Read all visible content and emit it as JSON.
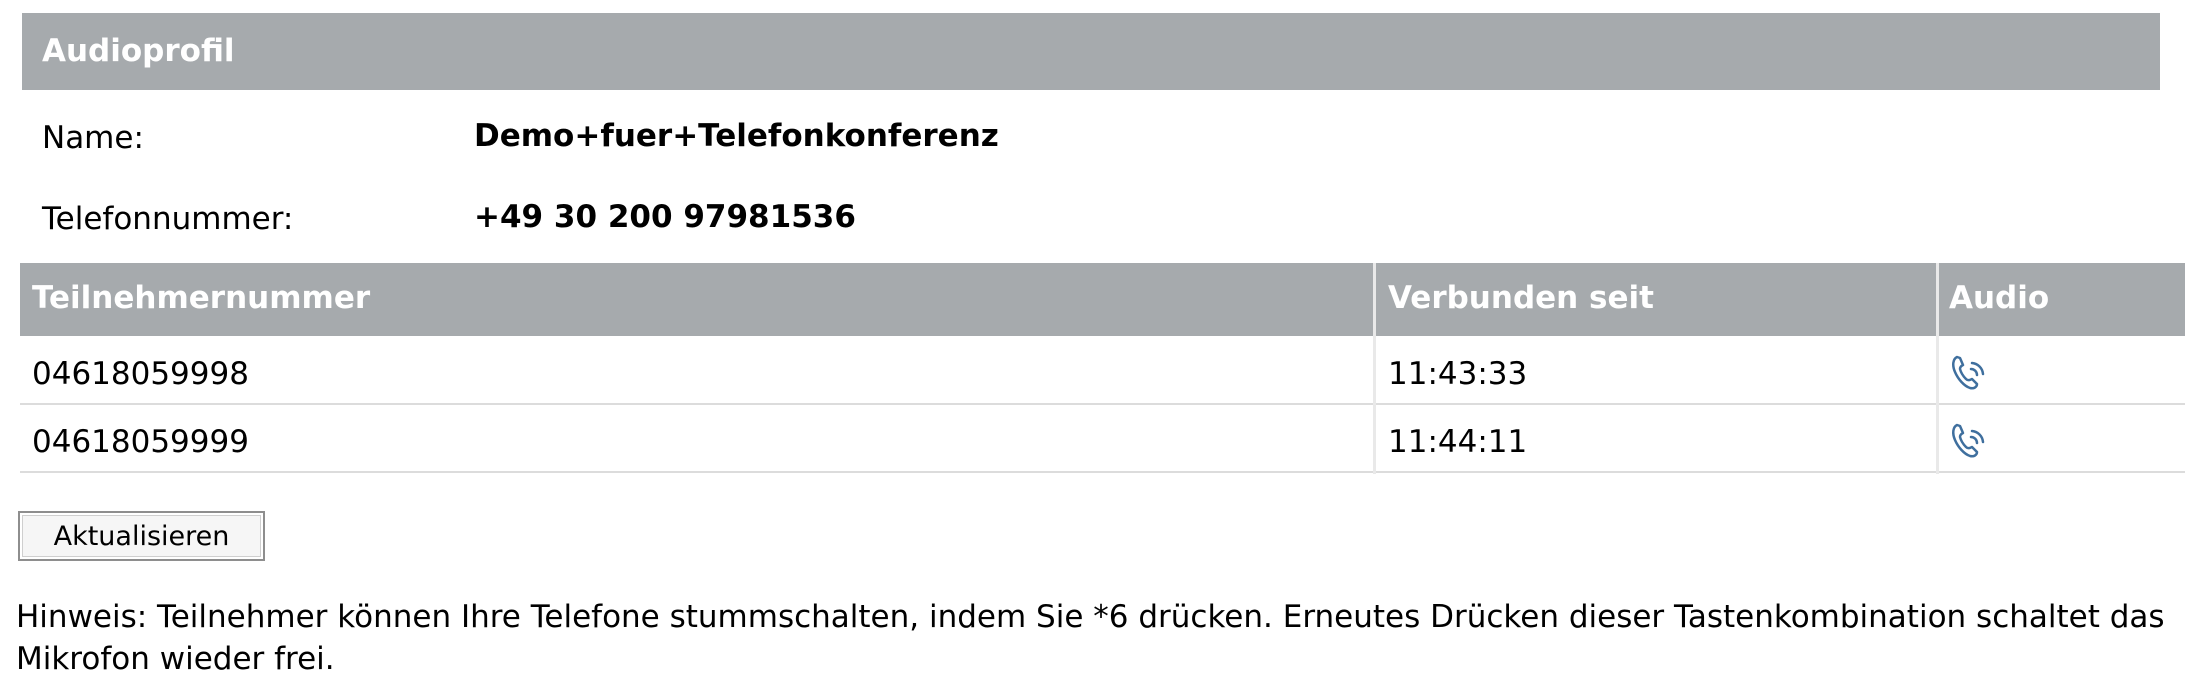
{
  "profile": {
    "header": "Audioprofil",
    "name_label": "Name:",
    "name_value": "Demo+fuer+Telefonkonferenz",
    "phone_label": "Telefonnummer:",
    "phone_value": "+49 30 200 97981536"
  },
  "participants": {
    "columns": [
      "Teilnehmernummer",
      "Verbunden seit",
      "Audio"
    ],
    "rows": [
      {
        "number": "04618059998",
        "since": "11:43:33",
        "audio_icon": "phone-audio-icon"
      },
      {
        "number": "04618059999",
        "since": "11:44:11",
        "audio_icon": "phone-audio-icon"
      }
    ]
  },
  "actions": {
    "refresh_label": "Aktualisieren"
  },
  "hint": "Hinweis: Teilnehmer können Ihre Telefone stummschalten, indem Sie *6 drücken. Erneutes Drücken dieser Tastenkombination schaltet das Mikrofon wieder frei.",
  "colors": {
    "header_bg": "#a6aaad",
    "icon_stroke": "#3f6f9e"
  }
}
